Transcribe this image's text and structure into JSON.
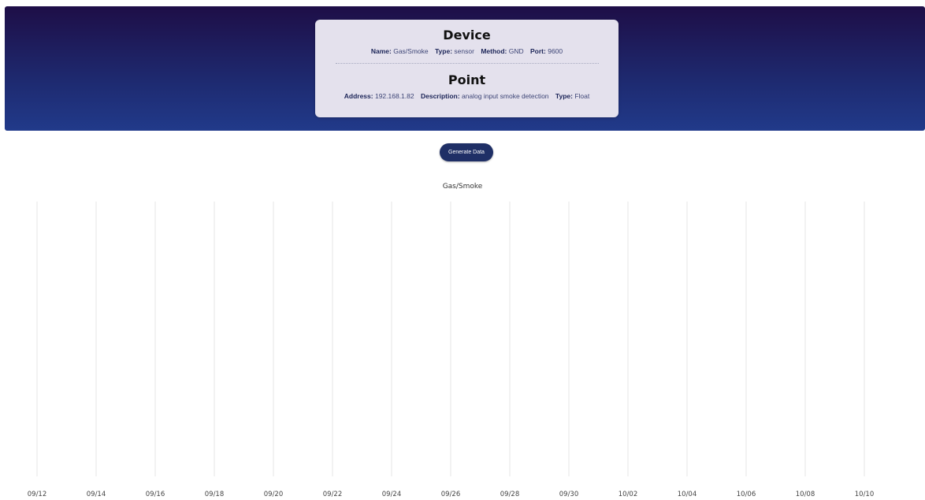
{
  "device": {
    "heading": "Device",
    "fields": [
      {
        "label": "Name:",
        "value": "Gas/Smoke"
      },
      {
        "label": "Type:",
        "value": "sensor"
      },
      {
        "label": "Method:",
        "value": "GND"
      },
      {
        "label": "Port:",
        "value": "9600"
      }
    ]
  },
  "point": {
    "heading": "Point",
    "fields": [
      {
        "label": "Address:",
        "value": "192.168.1.82"
      },
      {
        "label": "Description:",
        "value": "analog input smoke detection"
      },
      {
        "label": "Type:",
        "value": "Float"
      }
    ]
  },
  "actions": {
    "generate_label": "Generate Data"
  },
  "chart_data": {
    "type": "line",
    "title": "Gas/Smoke",
    "xlabel": "",
    "ylabel": "",
    "x_ticks": [
      "09/12",
      "09/14",
      "09/16",
      "09/18",
      "09/20",
      "09/22",
      "09/24",
      "09/26",
      "09/28",
      "09/30",
      "10/02",
      "10/04",
      "10/06",
      "10/08",
      "10/10"
    ],
    "series": [],
    "grid": "vertical"
  },
  "colors": {
    "header_top": "#1e0e47",
    "header_bottom": "#213a8a",
    "card_bg": "#e4e1ed",
    "button_bg": "#1f2f66",
    "grid_line": "#e6e6e6"
  }
}
